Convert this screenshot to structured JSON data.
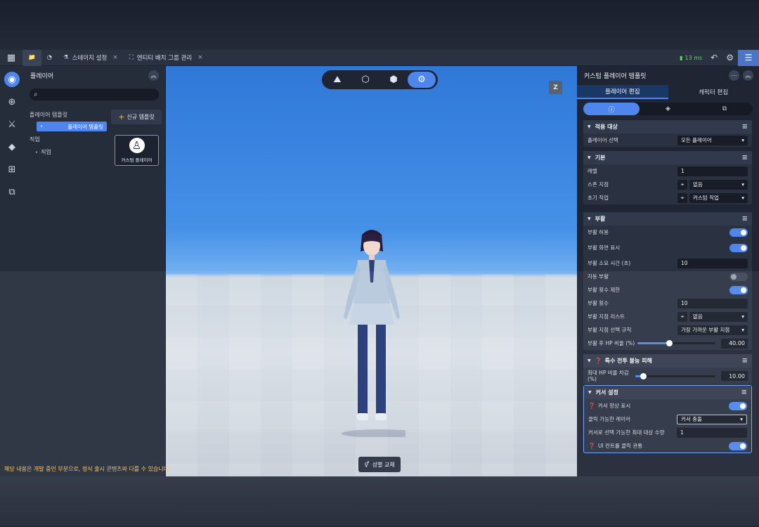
{
  "topbar": {
    "tabs": [
      {
        "label": "",
        "icon": "folder-icon"
      },
      {
        "label": "",
        "icon": "gauge-icon"
      },
      {
        "label": "스테이지 설정",
        "icon": "stage-icon"
      },
      {
        "label": "엔티티 배치 그룹 관리",
        "icon": "entity-icon"
      }
    ],
    "latency": "13 ms"
  },
  "left_panel": {
    "title": "플레이어",
    "search_placeholder": "",
    "section_templates": "플레이어 템플릿",
    "template_item": "플레이어 템플릿",
    "section_job": "직업",
    "job_item": "직업",
    "new_template": "신규 템플릿",
    "card_label": "커스텀 플레이어"
  },
  "viewport": {
    "z_label": "Z",
    "gender_button": "성별 교체",
    "notice": "해당 내용은 개발 중인 부분으로, 정식 출시 콘텐츠와 다를 수 있습니다."
  },
  "right_panel": {
    "title": "커스텀 플레이어 템플릿",
    "tabs": [
      "플레이어 편집",
      "캐릭터 편집"
    ],
    "apply": {
      "title": "적용 대상",
      "player_select_label": "플레이어 선택",
      "player_select_value": "모든 플레이어"
    },
    "basic": {
      "title": "기본",
      "level_label": "레벨",
      "level_value": "1",
      "spawn_label": "스폰 지점",
      "spawn_value": "없음",
      "job_label": "초기 직업",
      "job_value": "커스텀 직업"
    },
    "revive": {
      "title": "부활",
      "allow_label": "부활 허용",
      "screen_label": "부활 화면 표시",
      "time_label": "부활 소요 시간 (초)",
      "time_value": "10",
      "auto_label": "자동 부활",
      "limit_label": "부활 횟수 제한",
      "count_label": "부활 횟수",
      "count_value": "10",
      "point_list_label": "부활 지점 리스트",
      "point_list_value": "없음",
      "rule_label": "부활 지점 선택 규칙",
      "rule_value": "가장 가까운 부활 지점",
      "hp_label": "부활 후 HP 비율 (%)",
      "hp_value": "40.00",
      "hp_ratio": 0.4
    },
    "special": {
      "title": "특수 전투 불능 피해",
      "max_hp_label": "최대 HP 비율 차감 (%)",
      "max_hp_value": "10.00",
      "max_hp_ratio": 0.1
    },
    "cursor": {
      "title": "커서 설정",
      "always_label": "커서 항상 표시",
      "layer_label": "클릭 가능한 레이어",
      "layer_value": "커서 충돌",
      "max_label": "커서로 선택 가능한 최대 대상 수량",
      "max_value": "1",
      "ui_label": "UI 컨트롤 클릭 관통"
    }
  }
}
